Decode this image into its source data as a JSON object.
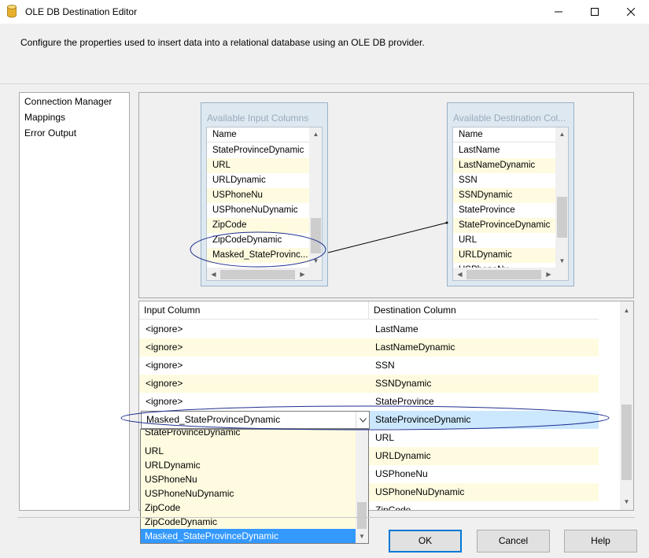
{
  "window": {
    "title": "OLE DB Destination Editor",
    "icon": "database-cylinder-icon",
    "controls": [
      "minimize-icon",
      "maximize-icon",
      "close-icon"
    ]
  },
  "description": "Configure the properties used to insert data into a relational database using an OLE DB provider.",
  "nav": {
    "items": [
      {
        "label": "Connection Manager"
      },
      {
        "label": "Mappings"
      },
      {
        "label": "Error Output"
      }
    ]
  },
  "input_columns": {
    "title": "Available Input Columns",
    "header": "Name",
    "rows": [
      "StateProvinceDynamic",
      "URL",
      "URLDynamic",
      "USPhoneNu",
      "USPhoneNuDynamic",
      "ZipCode",
      "ZipCodeDynamic",
      "Masked_StateProvinc..."
    ]
  },
  "destination_columns": {
    "title": "Available Destination Col...",
    "header": "Name",
    "rows": [
      "LastName",
      "LastNameDynamic",
      "SSN",
      "SSNDynamic",
      "StateProvince",
      "StateProvinceDynamic",
      "URL",
      "URLDynamic",
      "USPhoneNu"
    ]
  },
  "grid": {
    "headers": {
      "input": "Input Column",
      "destination": "Destination Column"
    },
    "rows": [
      {
        "input": "<ignore>",
        "destination": "LastName"
      },
      {
        "input": "<ignore>",
        "destination": "LastNameDynamic"
      },
      {
        "input": "<ignore>",
        "destination": "SSN"
      },
      {
        "input": "<ignore>",
        "destination": "SSNDynamic"
      },
      {
        "input": "<ignore>",
        "destination": "StateProvince"
      },
      {
        "input": "Masked_StateProvinceDynamic",
        "destination": "StateProvinceDynamic"
      },
      {
        "input": "",
        "destination": "URL"
      },
      {
        "input": "",
        "destination": "URLDynamic"
      },
      {
        "input": "",
        "destination": "USPhoneNu"
      },
      {
        "input": "",
        "destination": "USPhoneNuDynamic"
      },
      {
        "input": "",
        "destination": "ZipCode"
      }
    ],
    "combo_value": "Masked_StateProvinceDynamic"
  },
  "dropdown": {
    "options": [
      "StateProvinceDynamic",
      "URL",
      "URLDynamic",
      "USPhoneNu",
      "USPhoneNuDynamic",
      "ZipCode",
      "ZipCodeDynamic",
      "Masked_StateProvinceDynamic"
    ],
    "selected": "Masked_StateProvinceDynamic"
  },
  "buttons": {
    "ok": "OK",
    "cancel": "Cancel",
    "help": "Help"
  },
  "colors": {
    "alt_row": "#fffbe0",
    "selection": "#3399ff",
    "highlight_ellipse": "#1f2f8f"
  }
}
